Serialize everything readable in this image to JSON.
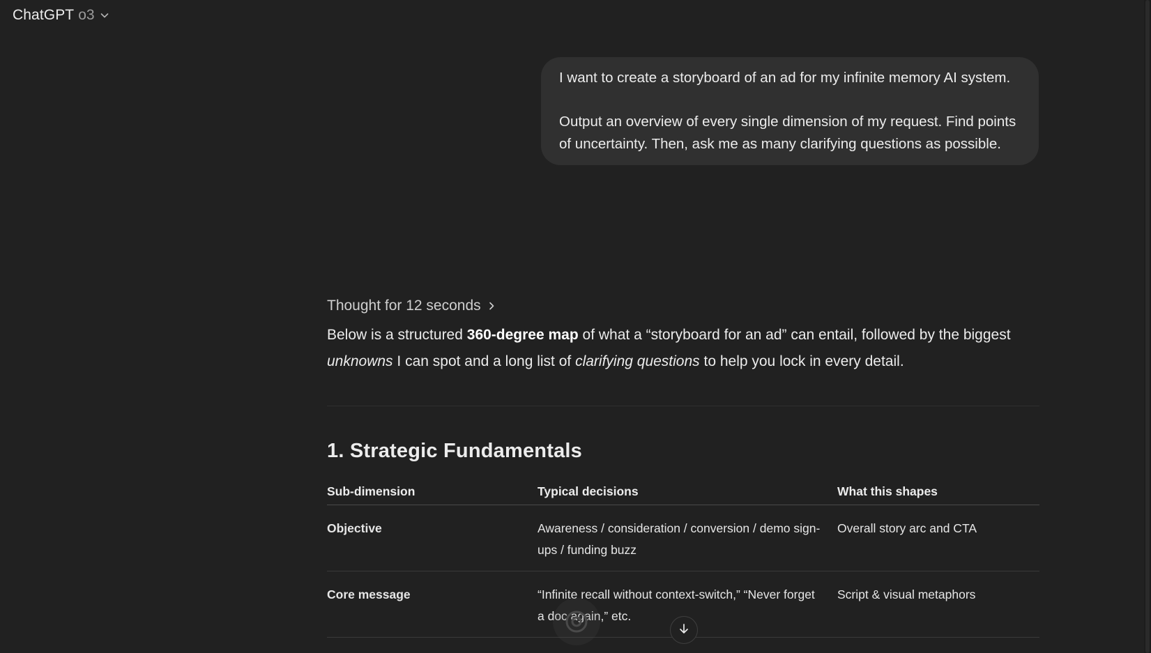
{
  "header": {
    "model_name": "ChatGPT",
    "model_version": "o3"
  },
  "user_message": {
    "paragraph_1": "I want to create a storyboard of an ad for my infinite memory AI system.",
    "paragraph_2": "Output an overview of every single dimension of my request. Find points of uncertainty. Then, ask me as many clarifying questions as possible."
  },
  "assistant": {
    "thought_label": "Thought for 12 seconds",
    "intro": {
      "part_1": "Below is a structured ",
      "bold_1": "360-degree map",
      "part_2": " of what a “storyboard for an ad” can entail, followed by the biggest ",
      "italic_1": "unknowns",
      "part_3": " I can spot and a long list of ",
      "italic_2": "clarifying questions",
      "part_4": " to help you lock in every detail."
    },
    "section_title": "1. Strategic Fundamentals",
    "table": {
      "headers": [
        "Sub-dimension",
        "Typical decisions",
        "What this shapes"
      ],
      "rows": [
        {
          "sub_dimension": "Objective",
          "decisions": "Awareness / consideration / conversion / demo sign-ups / funding buzz",
          "shapes": "Overall story arc and CTA"
        },
        {
          "sub_dimension": "Core message",
          "decisions": "“Infinite recall without context-switch,” “Never forget a doc again,” etc.",
          "shapes": "Script & visual metaphors"
        }
      ]
    }
  },
  "icons": {
    "model_chevron": "chevron-down-icon",
    "thought_chevron": "chevron-right-icon",
    "scroll_down": "arrow-down-icon"
  },
  "colors": {
    "background": "#212121",
    "bubble": "#303030",
    "text": "#ececec",
    "muted": "#9b9b9b"
  }
}
